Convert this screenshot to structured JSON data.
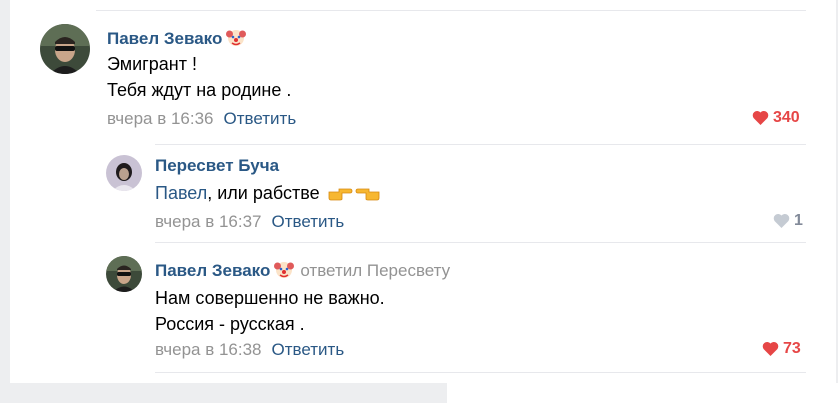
{
  "comments": [
    {
      "author": "Павел Зевако",
      "author_emoji": "clown-icon",
      "lines": [
        "Эмигрант !",
        "Тебя ждут на родине ."
      ],
      "time": "вчера в 16:36",
      "reply_label": "Ответить",
      "likes": "340",
      "liked": true
    },
    {
      "author": "Пересвет Буча",
      "mention": "Павел",
      "text_after_mention": ", или рабстве",
      "text_emoji": [
        "hand-pointing-right-icon",
        "hand-pointing-left-icon"
      ],
      "time": "вчера в 16:37",
      "reply_label": "Ответить",
      "likes": "1",
      "liked": false
    },
    {
      "author": "Павел Зевако",
      "author_emoji": "clown-icon",
      "replied_to": "ответил Пересвету",
      "lines": [
        "Нам совершенно не важно.",
        "Россия - русская ."
      ],
      "time": "вчера в 16:38",
      "reply_label": "Ответить",
      "likes": "73",
      "liked": true
    }
  ],
  "colors": {
    "author_link": "#2a5885",
    "muted": "#939393",
    "like_active": "#e64646",
    "like_inactive": "#828a99",
    "background": "#edeef0",
    "card": "#ffffff"
  }
}
